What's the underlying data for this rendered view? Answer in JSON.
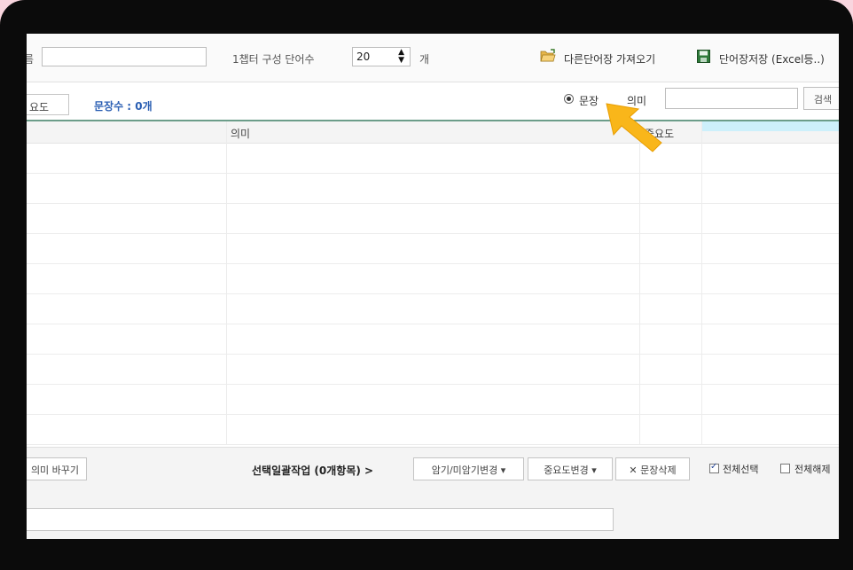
{
  "toolbar": {
    "name_label": "름",
    "chapter_label": "1챕터 구성 단어수",
    "chapter_count": "20",
    "unit_label": "개",
    "import_label": "다른단어장 가져오기",
    "save_label": "단어장저장 (Excel등..)"
  },
  "filter": {
    "importance_tab": "요도",
    "sentence_count": "문장수 : 0개",
    "radio_sentence": "문장",
    "radio_meaning": "의미",
    "search_button": "검색"
  },
  "table": {
    "headers": [
      "의미",
      "중요도"
    ],
    "rows": [
      {},
      {},
      {},
      {},
      {},
      {},
      {},
      {},
      {},
      {}
    ]
  },
  "bottombar": {
    "swap_button": "의미 바꾸기",
    "bulk_label": "선택일괄작업 (0개항목) >",
    "memorize_button": "암기/미암기변경 ▾",
    "importance_button": "중요도변경 ▾",
    "delete_button": "✕ 문장삭제",
    "select_all": "전체선택",
    "deselect_all": "전체해제"
  },
  "colors": {
    "count_text": "#2b5fb3",
    "arrow": "#f9b61a",
    "divider": "#6c9d8a"
  }
}
